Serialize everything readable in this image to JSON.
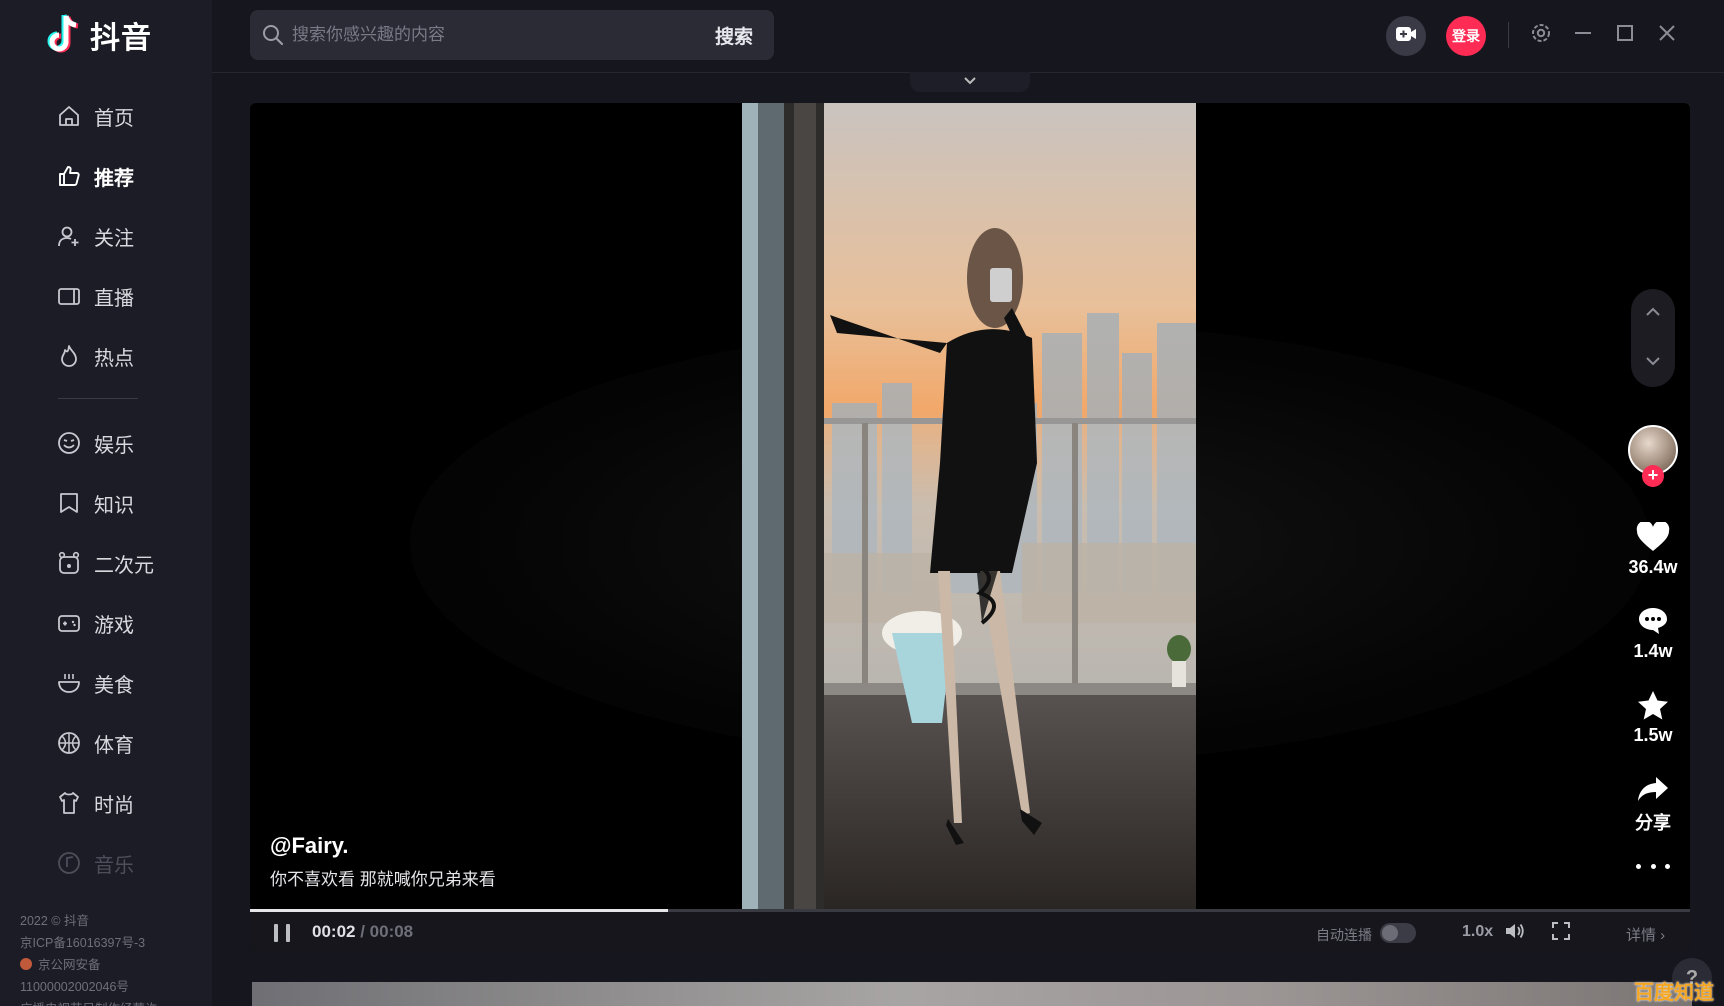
{
  "app": {
    "name": "抖音"
  },
  "sidebar": {
    "items": [
      {
        "label": "首页",
        "icon": "home-icon",
        "active": false
      },
      {
        "label": "推荐",
        "icon": "thumbs-up-icon",
        "active": true
      },
      {
        "label": "关注",
        "icon": "user-plus-icon",
        "active": false
      },
      {
        "label": "直播",
        "icon": "tv-icon",
        "active": false
      },
      {
        "label": "热点",
        "icon": "flame-icon",
        "active": false
      }
    ],
    "categories": [
      {
        "label": "娱乐",
        "icon": "smile-icon"
      },
      {
        "label": "知识",
        "icon": "bookmark-icon"
      },
      {
        "label": "二次元",
        "icon": "bear-icon"
      },
      {
        "label": "游戏",
        "icon": "gamepad-icon"
      },
      {
        "label": "美食",
        "icon": "bowl-icon"
      },
      {
        "label": "体育",
        "icon": "ball-icon"
      },
      {
        "label": "时尚",
        "icon": "shirt-icon"
      },
      {
        "label": "音乐",
        "icon": "music-icon"
      }
    ],
    "footer": {
      "copyright": "2022 © 抖音",
      "icp": "京ICP备16016397号-3",
      "police": "京公网安备",
      "police_no": "11000002002046号",
      "license": "广播电视节目制作经营许"
    }
  },
  "search": {
    "placeholder": "搜索你感兴趣的内容",
    "button": "搜索"
  },
  "topbar": {
    "login_label": "登录"
  },
  "video": {
    "author": "@Fairy.",
    "caption": "你不喜欢看 那就喊你兄弟来看",
    "current_time": "00:02",
    "separator": " / ",
    "duration": "00:08",
    "progress": 0.29,
    "autoplay_label": "自动连播",
    "autoplay_on": false,
    "speed": "1.0x",
    "details_label": "详情 ›"
  },
  "actions": {
    "likes": "36.4w",
    "comments": "1.4w",
    "favorites": "1.5w",
    "share": "分享"
  },
  "colors": {
    "accent": "#fe2c55",
    "bg": "#16161f",
    "sidebar": "#1c1c26"
  },
  "watermark": "百度知道"
}
